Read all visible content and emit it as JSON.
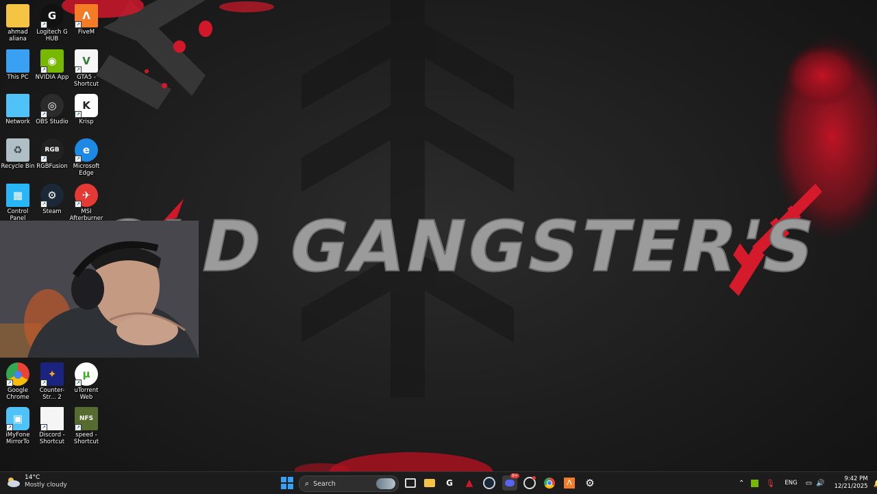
{
  "desktop": {
    "icons": [
      {
        "label": "ahmad aliana",
        "icon": "folder-icon"
      },
      {
        "label": "Logitech G HUB",
        "icon": "logitech-g-icon"
      },
      {
        "label": "FiveM",
        "icon": "fivem-icon"
      },
      {
        "label": "This PC",
        "icon": "monitor-icon"
      },
      {
        "label": "NVIDIA App",
        "icon": "nvidia-icon"
      },
      {
        "label": "GTA5 - Shortcut",
        "icon": "gta5-icon"
      },
      {
        "label": "Network",
        "icon": "network-icon"
      },
      {
        "label": "OBS Studio",
        "icon": "obs-icon"
      },
      {
        "label": "Krisp",
        "icon": "krisp-icon"
      },
      {
        "label": "Recycle Bin",
        "icon": "recycle-bin-icon"
      },
      {
        "label": "RGBFusion",
        "icon": "rgbfusion-icon"
      },
      {
        "label": "Microsoft Edge",
        "icon": "edge-icon"
      },
      {
        "label": "Control Panel",
        "icon": "control-panel-icon"
      },
      {
        "label": "Steam",
        "icon": "steam-icon"
      },
      {
        "label": "MSI Afterburner",
        "icon": "msi-afterburner-icon"
      },
      {
        "label": "Google Chrome",
        "icon": "chrome-icon"
      },
      {
        "label": "Counter-Str... 2",
        "icon": "counter-strike-icon"
      },
      {
        "label": "uTorrent Web",
        "icon": "utorrent-icon"
      },
      {
        "label": "iMyFone MirrorTo",
        "icon": "imyfone-icon"
      },
      {
        "label": "Discord - Shortcut",
        "icon": "file-icon"
      },
      {
        "label": "speed - Shortcut",
        "icon": "nfs-icon"
      }
    ]
  },
  "wallpaper": {
    "title_text": "OLD GANGSTER'S",
    "accent": "#d0182a"
  },
  "taskbar": {
    "weather": {
      "temp": "14°C",
      "condition": "Mostly cloudy"
    },
    "search_placeholder": "Search",
    "apps": [
      "windows-start-icon",
      "task-view-icon",
      "file-explorer-icon",
      "logitech-g-icon",
      "red-app-icon",
      "steam-icon",
      "discord-icon",
      "obs-icon",
      "chrome-icon",
      "fivem-icon",
      "settings-icon"
    ],
    "discord_badge": "9+",
    "tray": {
      "language": "ENG",
      "time": "9:42 PM",
      "date": "12/21/2025"
    }
  }
}
